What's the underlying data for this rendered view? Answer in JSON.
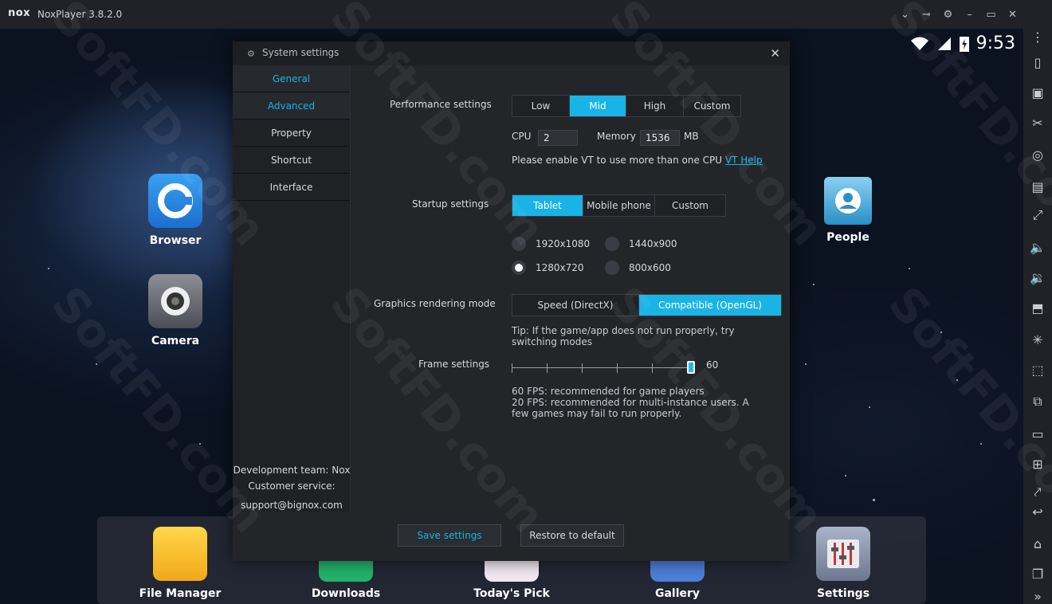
{
  "window": {
    "logo": "nox",
    "title": "NoxPlayer 3.8.2.0"
  },
  "title_controls": [
    "chevron-down-icon",
    "pin-icon",
    "gear-icon",
    "minimize-icon",
    "maximize-icon",
    "close-icon"
  ],
  "status": {
    "time": "9:53"
  },
  "desktop_apps": [
    {
      "label": "Browser"
    },
    {
      "label": "Camera"
    },
    {
      "label": "People"
    }
  ],
  "dock": {
    "apps": [
      "File Manager",
      "Downloads",
      "Today's Pick",
      "Gallery",
      "Settings"
    ]
  },
  "sidebar_tools": [
    "more-icon",
    "shake-icon",
    "video-icon",
    "cut-icon",
    "location-icon",
    "keyboard-icon",
    "fullscreen-icon",
    "volume-up-icon",
    "volume-down-icon",
    "apk-icon",
    "loading-icon",
    "macro-icon",
    "multi-icon",
    "screenshot-icon",
    "control-icon",
    "share-icon",
    "back-icon",
    "home-icon",
    "recent-icon",
    "expand-icon"
  ],
  "dialog": {
    "title": "System settings",
    "nav": [
      "General",
      "Advanced",
      "Property",
      "Shortcut",
      "Interface"
    ],
    "footer": [
      "Development team: Nox",
      "Customer service:",
      "support@bignox.com"
    ],
    "performance": {
      "label": "Performance settings",
      "options": [
        "Low",
        "Mid",
        "High",
        "Custom"
      ],
      "selected": "Mid",
      "cpu_label": "CPU",
      "cpu_value": "2",
      "memory_label": "Memory",
      "memory_value": "1536",
      "memory_unit": "MB",
      "vt_note": "Please enable VT to use more than one CPU",
      "vt_link": "VT Help"
    },
    "startup": {
      "label": "Startup settings",
      "options": [
        "Tablet",
        "Mobile phone",
        "Custom"
      ],
      "selected": "Tablet",
      "resolutions": [
        "1920x1080",
        "1440x900",
        "1280x720",
        "800x600"
      ],
      "selected_resolution": "1280x720"
    },
    "graphics": {
      "label": "Graphics rendering mode",
      "options": [
        "Speed (DirectX)",
        "Compatible (OpenGL)"
      ],
      "selected": "Compatible (OpenGL)",
      "tip": "Tip: If the game/app does not run properly, try switching modes"
    },
    "frame": {
      "label": "Frame settings",
      "value": "60",
      "note1": "60 FPS: recommended for game players",
      "note2": "20 FPS: recommended for multi-instance users. A few games may fail to run properly."
    },
    "buttons": {
      "save": "Save settings",
      "restore": "Restore to default"
    }
  },
  "watermark": "SoftFD.com",
  "colors": {
    "accent": "#1ab3e6",
    "dialog_bg": "#232529",
    "titlebar": "#202227"
  }
}
